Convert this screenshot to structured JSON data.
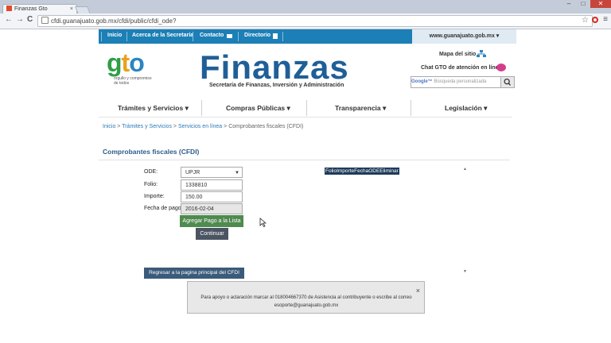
{
  "browser": {
    "tab_title": "Finanzas Gto",
    "tab_close": "×",
    "url": "cfdi.guanajuato.gob.mx/cfdi/public/cfdi_ode?",
    "back": "←",
    "forward": "→",
    "reload": "C",
    "star": "☆",
    "menu": "≡",
    "minimize": "–",
    "maximize": "□",
    "close": "✕"
  },
  "topbar": {
    "items": [
      "Inicio",
      "Acerca de la Secretaría",
      "Contacto",
      "Directorio"
    ],
    "domain": "www.guanajuato.gob.mx ▾"
  },
  "logo": {
    "g": "g",
    "t": "t",
    "o": "o",
    "slogan": "orgullo y compromiso de todos"
  },
  "header": {
    "title": "Finanzas",
    "subtitle": "Secretaría de Finanzas, Inversión y Administración",
    "site_map": "Mapa del sitio",
    "chat": "Chat GTO de atención en línea",
    "search_brand": "Google™",
    "search_placeholder": "Búsqueda personalizada"
  },
  "main_nav": [
    "Trámites y Servicios ▾",
    "Compras Públicas ▾",
    "Transparencia ▾",
    "Legislación ▾"
  ],
  "breadcrumb": {
    "links": [
      "Inicio",
      "Trámites y Servicios",
      "Servicios en línea"
    ],
    "separator": " > ",
    "current": "Comprobantes fiscales (CFDI)"
  },
  "page": {
    "title": "Comprobantes fiscales (CFDI)"
  },
  "form": {
    "ode_label": "ODE:",
    "ode_value": "UPJR",
    "folio_label": "Folio:",
    "folio_value": "1338810",
    "importe_label": "Importe:",
    "importe_value": "150.00",
    "fecha_label": "Fecha de pago:",
    "fecha_value": "2016-02-04",
    "add_button": "Agregar Pago a la Lista",
    "continue_button": "Continuar",
    "back_button": "Regresar a la pagina principal del CFDI"
  },
  "table": {
    "header": "FolioImporteFechaODEEliminar"
  },
  "notice": {
    "text": "Para apoyo o aclaración marcar al 018004667370 de Asistencia al contribuyente o escribe al correo esoporte@guanajuato.gob.mx",
    "close": "×"
  },
  "colors": {
    "topbar": "#1c7fb6",
    "finanzas_title": "#1f5f97",
    "add_button": "#4f8a4f",
    "continue_button": "#4b5562",
    "back_button": "#3b5b7a"
  }
}
